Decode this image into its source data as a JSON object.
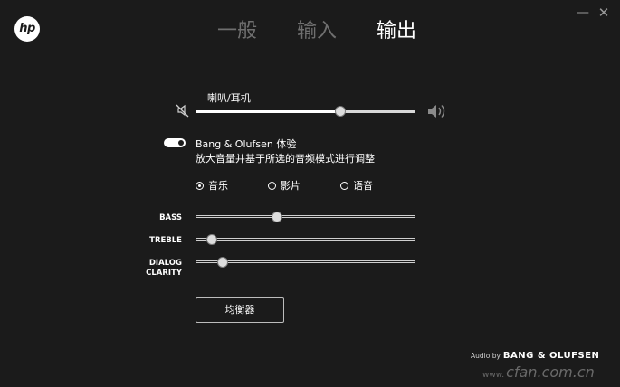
{
  "header": {
    "logo_text": "hp",
    "tabs": [
      {
        "label": "一般",
        "active": false
      },
      {
        "label": "输入",
        "active": false
      },
      {
        "label": "输出",
        "active": true
      }
    ],
    "window_controls": {
      "minimize": "—",
      "close": "✕"
    }
  },
  "volume": {
    "device_label": "喇叭/耳机",
    "level_percent": 66,
    "mute_icon": "speaker-muted-icon",
    "speaker_icon": "speaker-loud-icon"
  },
  "bang_olufsen": {
    "enabled": true,
    "title": "Bang & Olufsen 体验",
    "description": "放大音量并基于所选的音频模式进行调整",
    "modes": [
      {
        "label": "音乐",
        "selected": true
      },
      {
        "label": "影片",
        "selected": false
      },
      {
        "label": "语音",
        "selected": false
      }
    ]
  },
  "eq_sliders": [
    {
      "label": "BASS",
      "level_percent": 37
    },
    {
      "label": "TREBLE",
      "level_percent": 7
    },
    {
      "label": "DIALOG\nCLARITY",
      "level_percent": 12
    }
  ],
  "equalizer_button": "均衡器",
  "footer": {
    "audio_by": "Audio by",
    "brand": "BANG & OLUFSEN",
    "watermark_prefix": "www.",
    "watermark_site": "cfan.com.cn"
  },
  "colors": {
    "background": "#1b1b1b",
    "text": "#ffffff",
    "inactive_tab": "#6f6f6f"
  }
}
